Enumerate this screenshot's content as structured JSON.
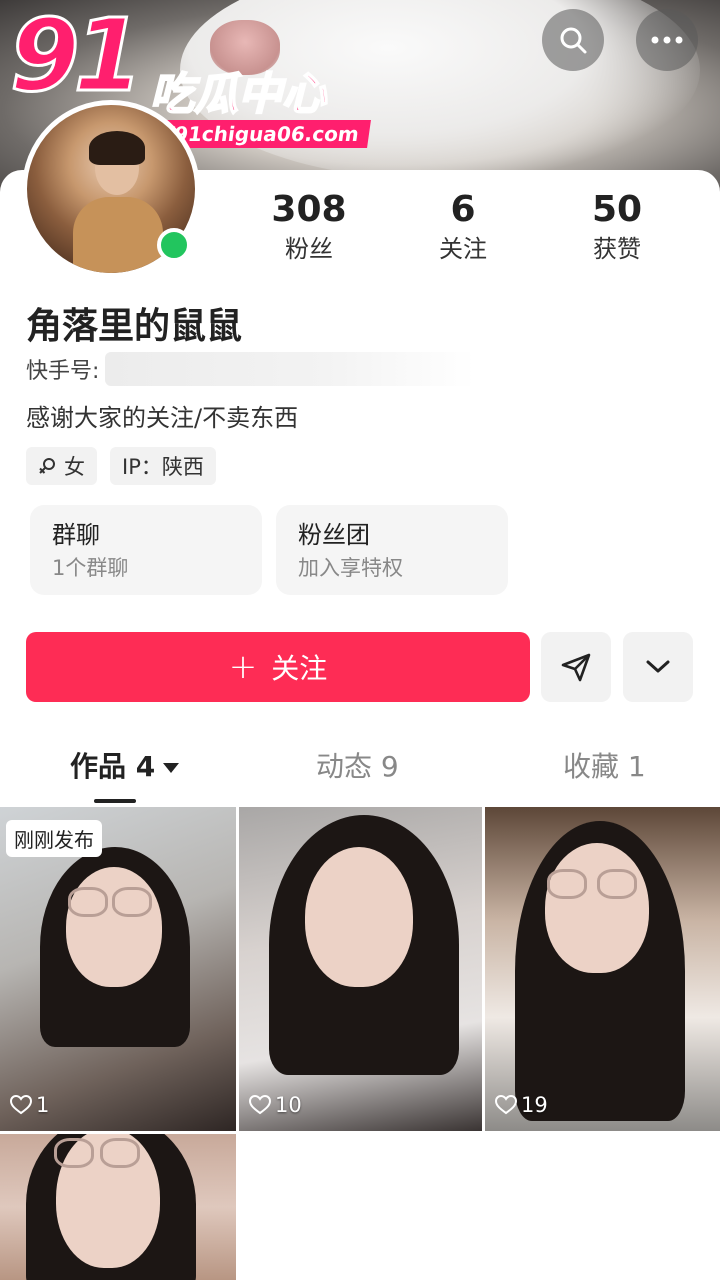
{
  "watermark": {
    "logo_number": "91",
    "logo_name": "吃瓜中心",
    "url": "https://91chigua06.com"
  },
  "header": {
    "search_icon": "search-icon",
    "more_icon": "more-horizontal-icon"
  },
  "profile": {
    "stats": [
      {
        "value": "308",
        "label": "粉丝"
      },
      {
        "value": "6",
        "label": "关注"
      },
      {
        "value": "50",
        "label": "获赞"
      }
    ],
    "nickname": "角落里的鼠鼠",
    "kuaishou_id_label": "快手号:",
    "bio": "感谢大家的关注/不卖东西",
    "gender_tag": "女",
    "ip_tag": "IP：陕西",
    "online_color": "#22c55e"
  },
  "cards": {
    "group": {
      "title": "群聊",
      "subtitle": "1个群聊"
    },
    "fan_club": {
      "title": "粉丝团",
      "subtitle": "加入享特权"
    }
  },
  "actions": {
    "follow_label": "关注",
    "follow_color": "#fe2c55",
    "share_icon": "send-icon",
    "dropdown_icon": "chevron-down-icon"
  },
  "tabs": [
    {
      "label": "作品 4",
      "active": true
    },
    {
      "label": "动态 9",
      "active": false
    },
    {
      "label": "收藏 1",
      "active": false
    }
  ],
  "posts": [
    {
      "badge": "刚刚发布",
      "likes": "1"
    },
    {
      "badge": "",
      "likes": "10"
    },
    {
      "badge": "",
      "likes": "19"
    },
    {
      "badge": "",
      "likes": ""
    }
  ]
}
